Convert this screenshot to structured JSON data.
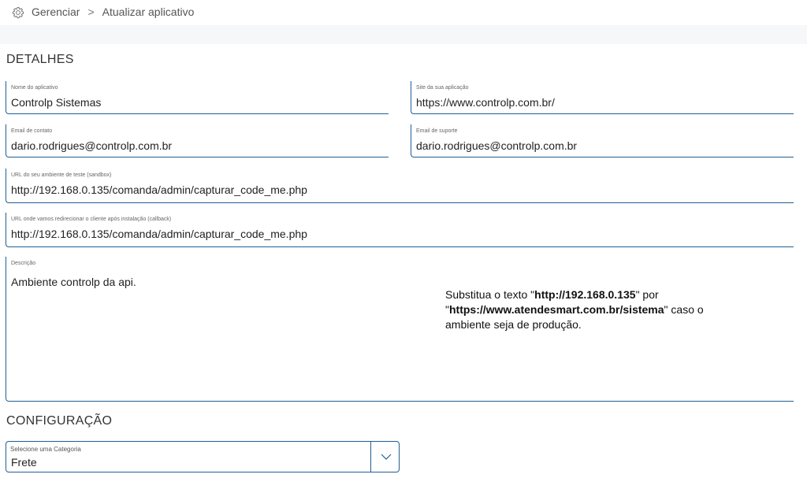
{
  "breadcrumb": {
    "items": [
      "Gerenciar",
      "Atualizar aplicativo"
    ],
    "separator": ">"
  },
  "details": {
    "title": "DETALHES",
    "app_name": {
      "label": "Nome do aplicativo",
      "value": "Controlp Sistemas"
    },
    "app_site": {
      "label": "Site da sua aplicação",
      "value": "https://www.controlp.com.br/"
    },
    "contact_email": {
      "label": "Email de contato",
      "value": "dario.rodrigues@controlp.com.br"
    },
    "support_email": {
      "label": "Email de suporte",
      "value": "dario.rodrigues@controlp.com.br"
    },
    "sandbox_url": {
      "label": "URL do seu ambiente de teste (sandbox)",
      "value": "http://192.168.0.135/comanda/admin/capturar_code_me.php"
    },
    "callback_url": {
      "label": "URL onde vamos redirecionar o cliente após instalação (callback)",
      "value": "http://192.168.0.135/comanda/admin/capturar_code_me.php"
    },
    "description": {
      "label": "Descrição",
      "value": "Ambiente controlp da api."
    }
  },
  "note": {
    "part1": "Substitua o texto \"",
    "bold1": "http://192.168.0.135",
    "part2": "\" por \"",
    "bold2": "https://www.atendesmart.com.br/sistema",
    "part3": "\" caso o ambiente seja de produção."
  },
  "configuration": {
    "title": "CONFIGURAÇÃO",
    "category": {
      "label": "Selecione uma Categoria",
      "value": "Frete"
    }
  },
  "colors": {
    "accent": "#1f5f97",
    "band": "#f6f7f8"
  },
  "icons": {
    "breadcrumb": "gear-icon",
    "select": "chevron-down-icon"
  }
}
